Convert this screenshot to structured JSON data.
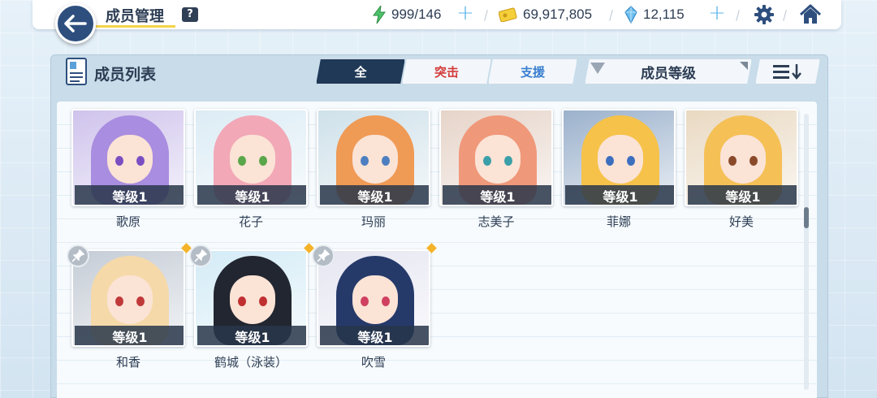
{
  "header": {
    "title": "成员管理",
    "help_label": "?",
    "resources": {
      "stamina": "999/146",
      "credits": "69,917,805",
      "gems": "12,115"
    }
  },
  "panel": {
    "title": "成员列表",
    "tabs": [
      {
        "label": "全",
        "active": true
      },
      {
        "label": "突击",
        "active": false
      },
      {
        "label": "支援",
        "active": false
      }
    ],
    "sort_label": "成员等级"
  },
  "members": [
    {
      "name": "歌原",
      "level": "等级1",
      "hair": "#a98de0",
      "eye": "#7a4fc2",
      "bg": "#cfc3ec",
      "pinned": false
    },
    {
      "name": "花子",
      "level": "等级1",
      "hair": "#f2a8b7",
      "eye": "#5aa64a",
      "bg": "#dcecf5",
      "pinned": false
    },
    {
      "name": "玛丽",
      "level": "等级1",
      "hair": "#ef9a55",
      "eye": "#4d7fc0",
      "bg": "#cfe1ea",
      "pinned": false
    },
    {
      "name": "志美子",
      "level": "等级1",
      "hair": "#f0987a",
      "eye": "#3a9fa8",
      "bg": "#e6d4c9",
      "pinned": false
    },
    {
      "name": "菲娜",
      "level": "等级1",
      "hair": "#f6c24a",
      "eye": "#3d6fbf",
      "bg": "#9bb1cc",
      "pinned": false
    },
    {
      "name": "好美",
      "level": "等级1",
      "hair": "#f5c056",
      "eye": "#8a4a2a",
      "bg": "#e9d9c2",
      "pinned": false
    },
    {
      "name": "和香",
      "level": "等级1",
      "hair": "#f5d9a8",
      "eye": "#c03a3a",
      "bg": "#c5ccd6",
      "pinned": true
    },
    {
      "name": "鹤城（泳装）",
      "level": "等级1",
      "hair": "#222630",
      "eye": "#c03030",
      "bg": "#d3ebf6",
      "pinned": true
    },
    {
      "name": "吹雪",
      "level": "等级1",
      "hair": "#263a6a",
      "eye": "#d04060",
      "bg": "#e6e6f2",
      "pinned": true
    }
  ]
}
